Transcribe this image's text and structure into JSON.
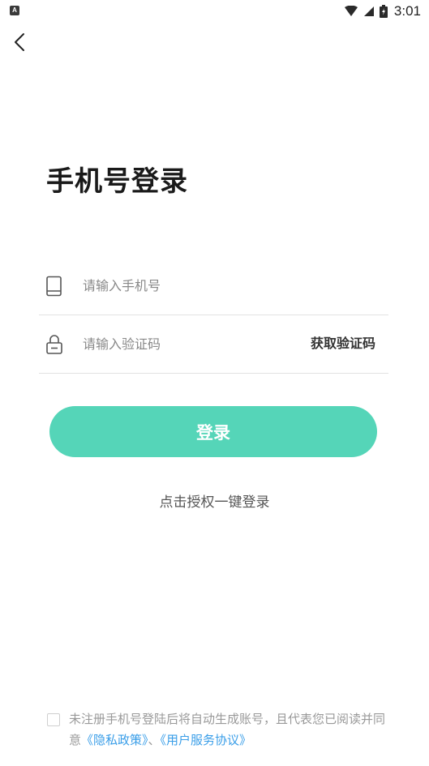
{
  "status_bar": {
    "notification_icon": "A",
    "time": "3:01",
    "icons": [
      "wifi-icon",
      "signal-icon",
      "battery-icon"
    ]
  },
  "nav": {
    "back_icon": "chevron-left-icon"
  },
  "page": {
    "title": "手机号登录"
  },
  "form": {
    "phone": {
      "icon": "phone-icon",
      "placeholder": "请输入手机号",
      "value": ""
    },
    "code": {
      "icon": "lock-icon",
      "placeholder": "请输入验证码",
      "value": "",
      "get_code_label": "获取验证码"
    },
    "login_label": "登录",
    "one_click_label": "点击授权一键登录"
  },
  "agreement": {
    "checked": false,
    "text_before": "未注册手机号登陆后将自动生成账号，且代表您已阅读并同意",
    "privacy_link": "《隐私政策》",
    "separator": "、",
    "terms_link": "《用户服务协议》"
  },
  "colors": {
    "accent": "#55d5b8",
    "link": "#3a9ee8",
    "placeholder": "#888888",
    "agreement_text": "#999999",
    "divider": "#e2e2e2"
  }
}
